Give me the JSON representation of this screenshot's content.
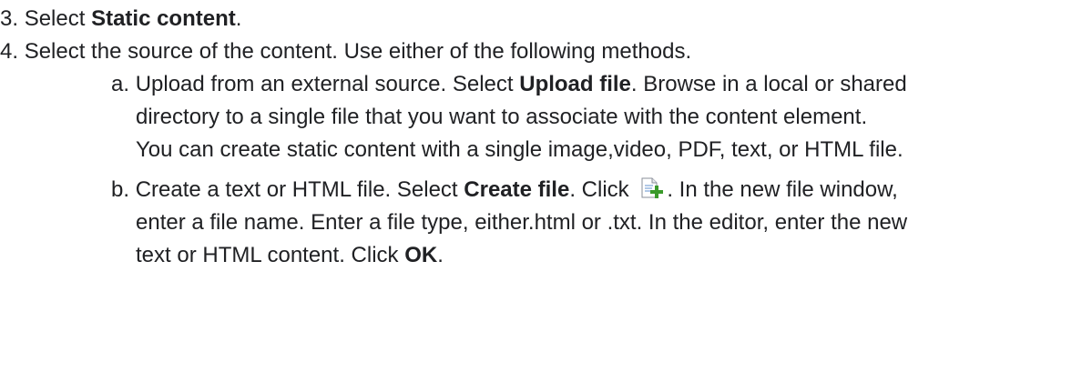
{
  "steps": [
    {
      "number": "3.",
      "pre": "Select ",
      "bold": "Static content",
      "post": "."
    },
    {
      "number": "4.",
      "text": "Select the source of the content. Use either of the following methods."
    }
  ],
  "sub_a": {
    "letter": "a.",
    "pre": "Upload from an external source. Select ",
    "bold": "Upload file",
    "post": ". Browse in a local or shared",
    "line2": "directory to a single file that you want to associate with the content element.",
    "line3": "You can create static content with a single image,video, PDF, text, or HTML file."
  },
  "sub_b": {
    "letter": "b.",
    "pre": "Create a text or HTML file. Select ",
    "bold": "Create file",
    "mid": ". Click ",
    "post": ". In the new file window,",
    "line2": "enter a file name. Enter a file type, either.html or .txt. In the editor, enter the new",
    "line3_pre": "text or HTML content. Click ",
    "line3_bold": "OK",
    "line3_post": ".",
    "icon": "new-file-plus-icon"
  },
  "colors": {
    "text": "#202124",
    "icon_plus": "#3a9a2a"
  }
}
